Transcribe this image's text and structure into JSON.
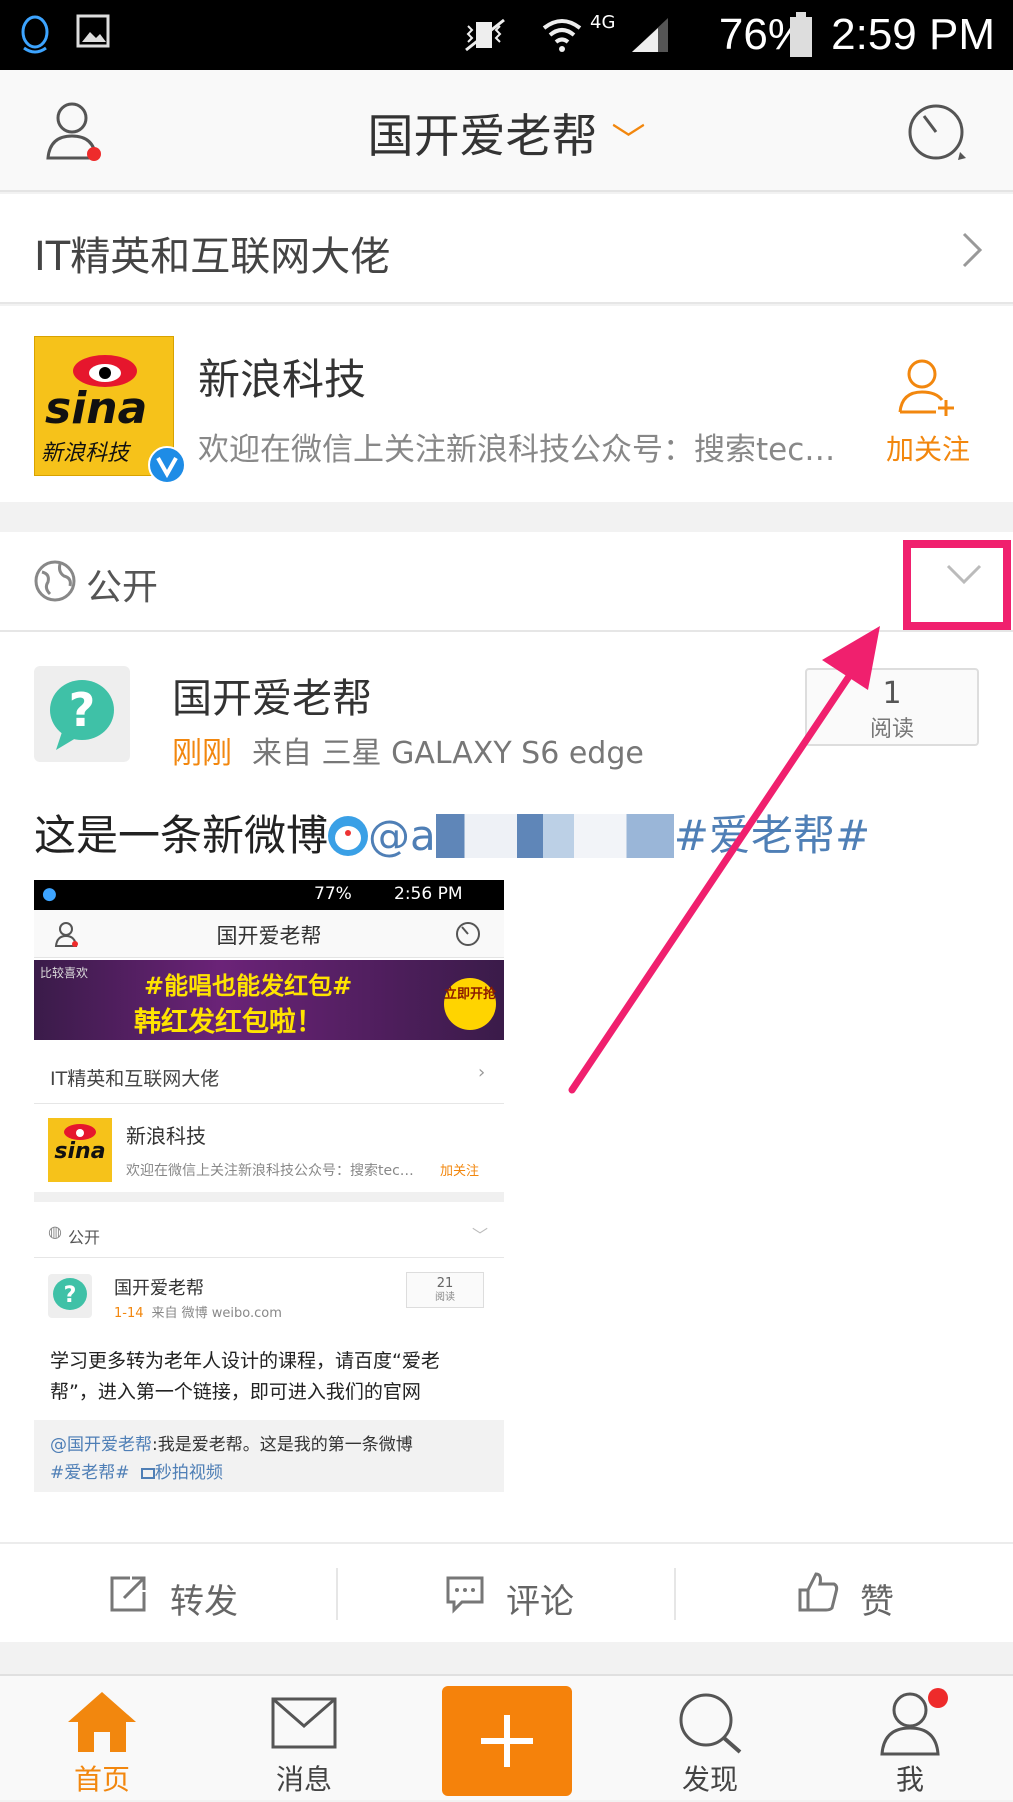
{
  "status_bar": {
    "battery": "76%",
    "time": "2:59 PM",
    "network": "4G"
  },
  "nav": {
    "title": "国开爱老帮"
  },
  "section": {
    "title": "IT精英和互联网大佬"
  },
  "recommended": {
    "name": "新浪科技",
    "description": "欢迎在微信上关注新浪科技公众号：搜索tec…",
    "follow_label": "加关注",
    "logo_text": "sina",
    "logo_sub": "新浪科技"
  },
  "visibility": {
    "label": "公开"
  },
  "post": {
    "author": "国开爱老帮",
    "time": "刚刚",
    "source": "来自 三星 GALAXY S6 edge",
    "reads_count": "1",
    "reads_label": "阅读",
    "text": "这是一条新微博",
    "mention": "@a",
    "hashtag": "#爱老帮#"
  },
  "screenshot": {
    "battery": "77%",
    "time": "2:56 PM",
    "nav_title": "国开爱老帮",
    "banner_tag": "比较喜欢",
    "banner_line1": "#能唱也能发红包#",
    "banner_line2": "韩红发红包啦！",
    "banner_button": "立即开抢",
    "section_title": "IT精英和互联网大佬",
    "rec_name": "新浪科技",
    "rec_desc": "欢迎在微信上关注新浪科技公众号：搜索tec…",
    "rec_follow": "加关注",
    "visibility": "公开",
    "post_author": "国开爱老帮",
    "post_time": "1-14",
    "post_source": "来自 微博 weibo.com",
    "post_reads": "21",
    "post_reads_label": "阅读",
    "post_text": "学习更多转为老年人设计的课程，请百度“爱老帮”，进入第一个链接，即可进入我们的官网",
    "retweet_mention": "@国开爱老帮",
    "retweet_text": ":我是爱老帮。这是我的第一条微博",
    "retweet_tag": "#爱老帮#",
    "retweet_video": "秒拍视频"
  },
  "actions": {
    "repost": "转发",
    "comment": "评论",
    "like": "赞"
  },
  "tabs": {
    "home": "首页",
    "messages": "消息",
    "discover": "发现",
    "me": "我"
  },
  "colors": {
    "accent": "#f2870e",
    "link": "#4f7fb6",
    "annotation": "#f0206e",
    "badge": "#ee2b2b"
  }
}
